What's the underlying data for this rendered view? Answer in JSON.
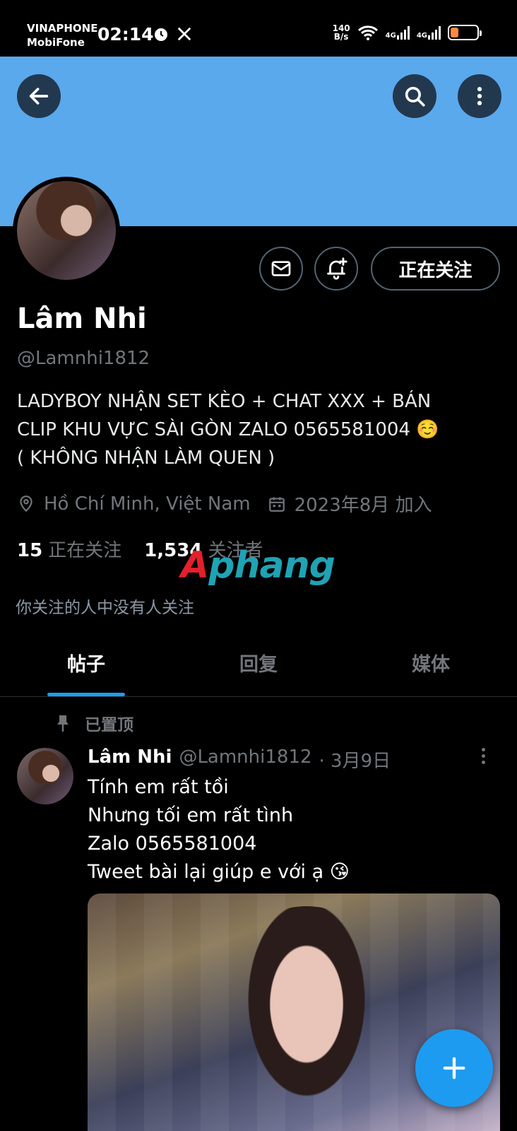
{
  "status_bar": {
    "carrier_1": "VINAPHONE",
    "carrier_2": "MobiFone",
    "time": "02:14",
    "net_speed_value": "140",
    "net_speed_unit": "B/s",
    "network_type": "4G",
    "battery_color": "#ff8a3d"
  },
  "header": {
    "banner_color": "#5aa9ec",
    "back_icon": "arrow-left-icon",
    "search_icon": "search-icon",
    "more_icon": "more-vertical-icon"
  },
  "profile": {
    "name": "Lâm Nhi",
    "handle": "@Lamnhi1812",
    "bio_line_1": "LADYBOY NHẬN SET KÈO + CHAT XXX + BÁN",
    "bio_line_2": "CLIP KHU VỰC SÀI GÒN ZALO 0565581004 ☺️",
    "bio_line_3": "( KHÔNG NHẬN LÀM QUEN )",
    "location": "Hồ Chí Minh, Việt Nam",
    "joined": "2023年8月 加入",
    "following_count": "15",
    "following_label": "正在关注",
    "followers_count": "1,534",
    "followers_label": "关注者",
    "followed_by_note": "你关注的人中没有人关注",
    "follow_button_label": "正在关注"
  },
  "watermark": {
    "part_1": "A",
    "part_2": "phang"
  },
  "tabs": [
    {
      "label": "帖子",
      "active": true
    },
    {
      "label": "回复",
      "active": false
    },
    {
      "label": "媒体",
      "active": false
    }
  ],
  "pinned_tweet": {
    "pinned_label": "已置顶",
    "author_name": "Lâm Nhi",
    "author_handle": "@Lamnhi1812",
    "date": "· 3月9日",
    "lines": [
      "Tính em rất tồi",
      "Nhưng tối em rất tình",
      "Zalo 0565581004",
      "Tweet bài lại giúp e với ạ 😘"
    ]
  },
  "fab": {
    "icon": "plus-icon",
    "color": "#1d9bf0"
  }
}
